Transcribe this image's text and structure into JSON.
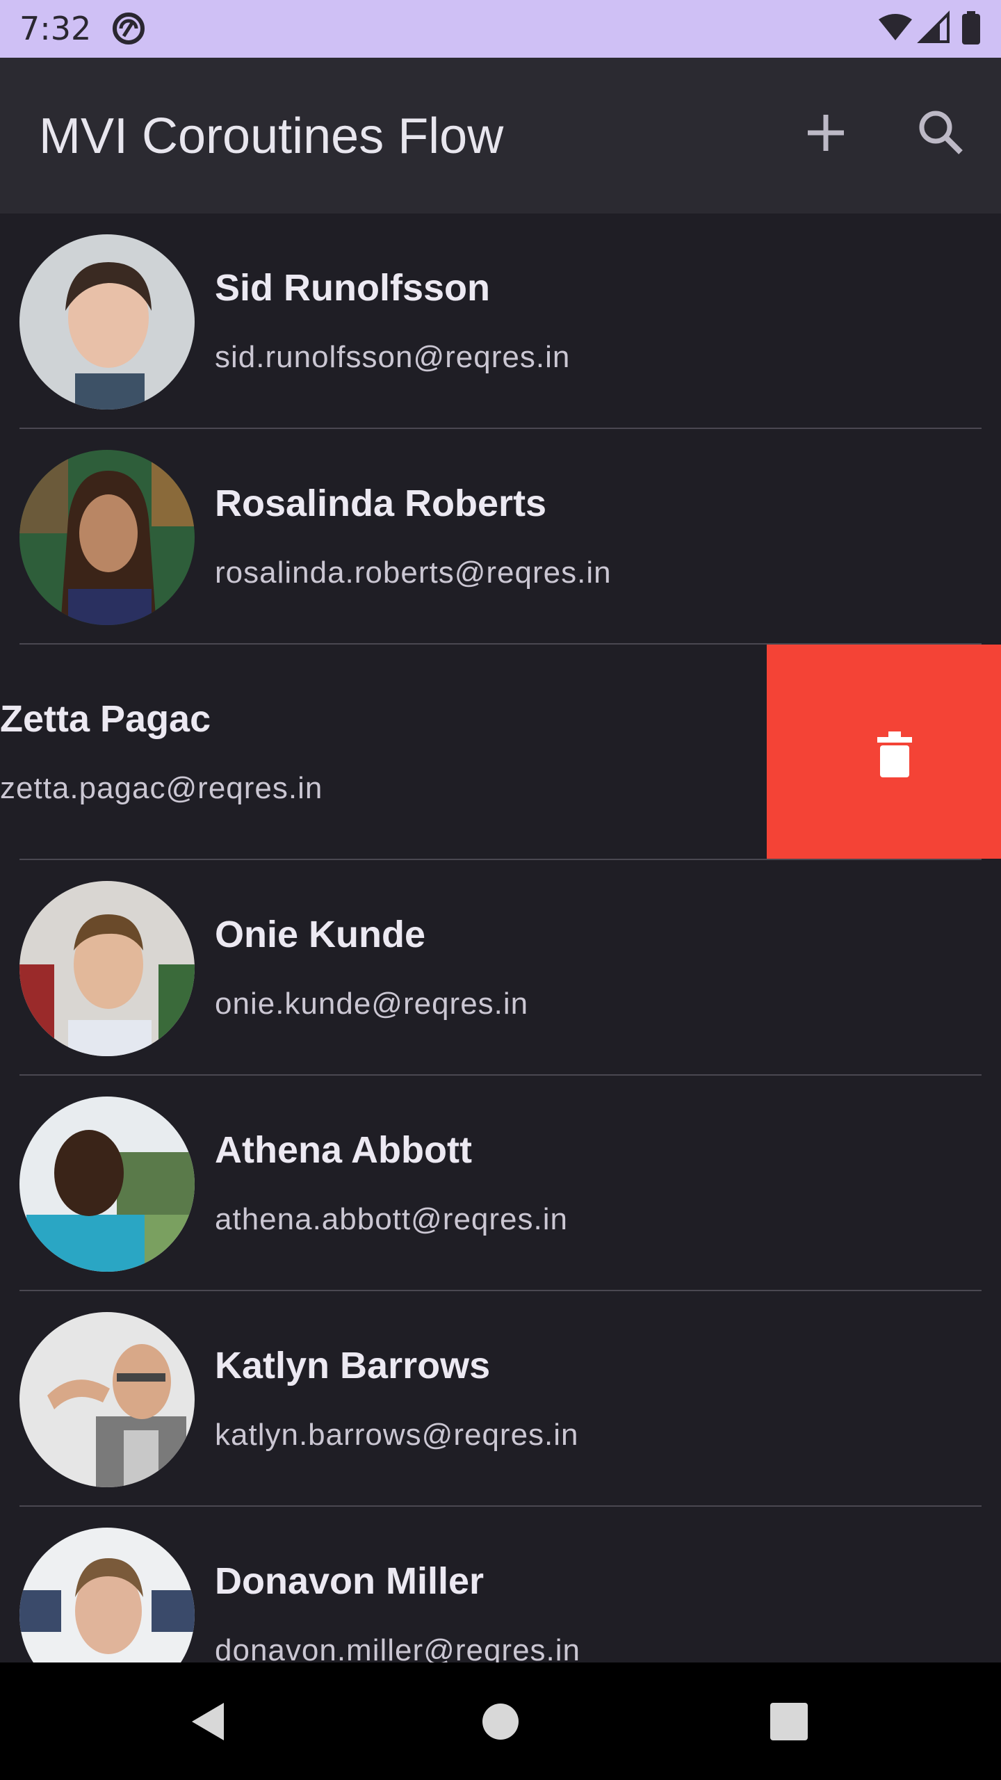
{
  "status_bar": {
    "time": "7:32"
  },
  "app_bar": {
    "title": "MVI Coroutines Flow",
    "actions": [
      "add-icon",
      "search-icon"
    ]
  },
  "users": [
    {
      "name": "Sid Runolfsson",
      "email": "sid.runolfsson@reqres.in"
    },
    {
      "name": "Rosalinda Roberts",
      "email": "rosalinda.roberts@reqres.in"
    },
    {
      "name": "Zetta Pagac",
      "email": "zetta.pagac@reqres.in",
      "swiped": true
    },
    {
      "name": "Onie Kunde",
      "email": "onie.kunde@reqres.in"
    },
    {
      "name": "Athena Abbott",
      "email": "athena.abbott@reqres.in"
    },
    {
      "name": "Katlyn Barrows",
      "email": "katlyn.barrows@reqres.in"
    },
    {
      "name": "Donavon Miller",
      "email": "donavon.miller@reqres.in"
    }
  ],
  "colors": {
    "delete": "#f44336",
    "background": "#1f1e25",
    "app_bar": "#2b2a31",
    "status_bar": "#cfc0f5"
  }
}
